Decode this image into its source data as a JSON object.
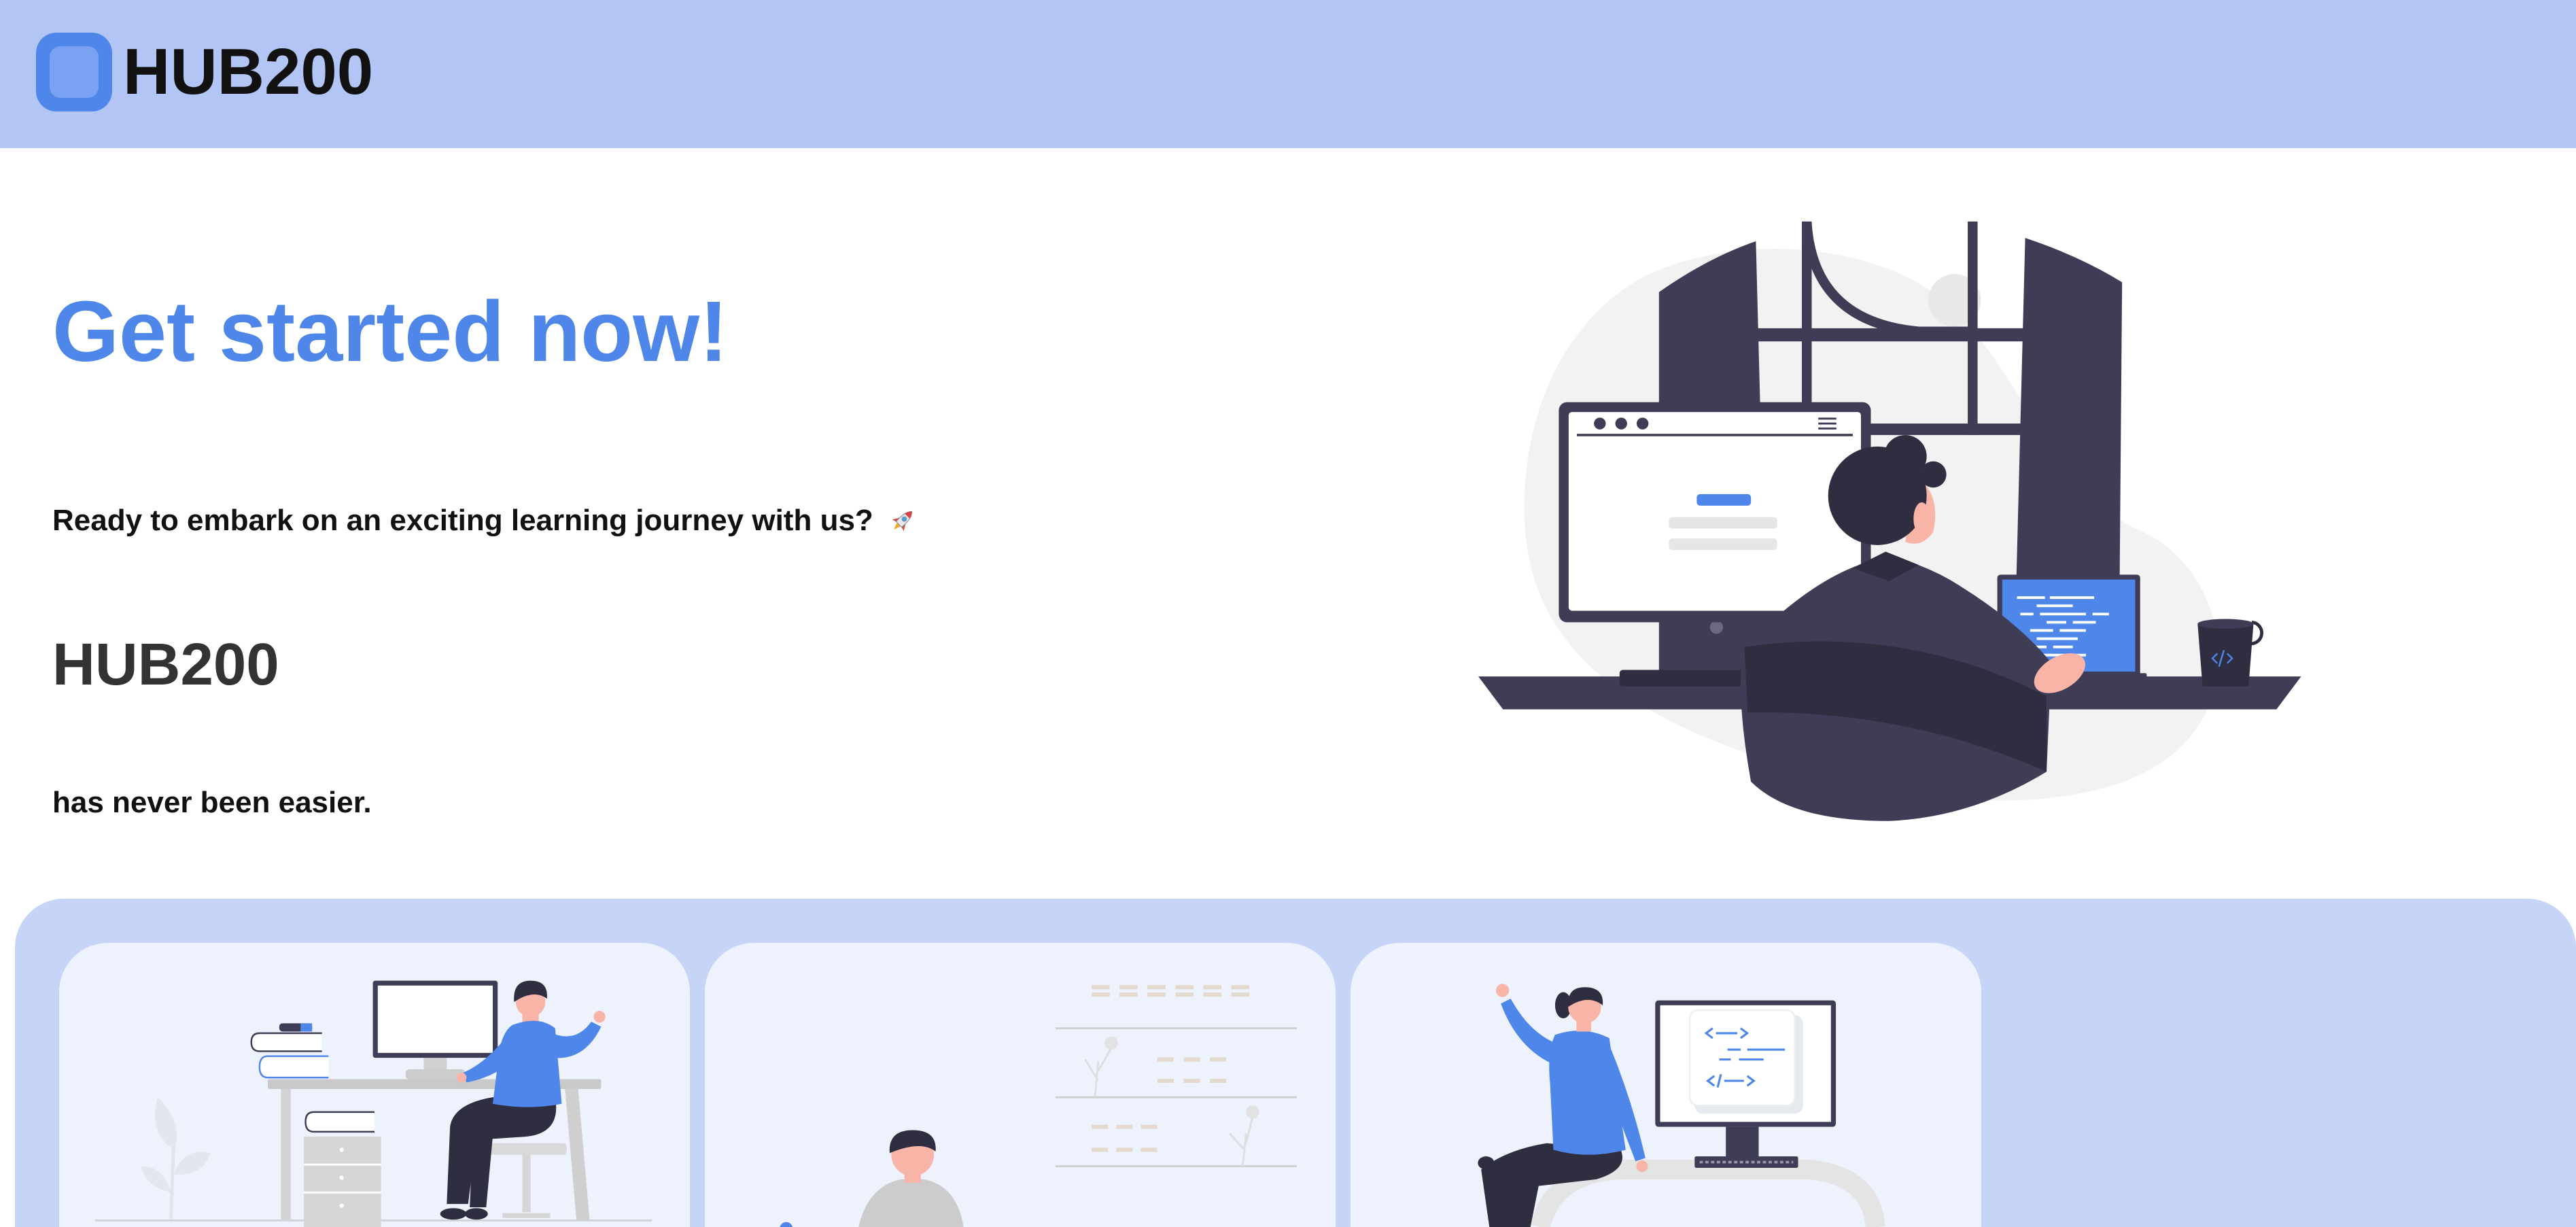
{
  "header": {
    "brand": "HUB200",
    "logo_icon": "logo-square-icon"
  },
  "hero": {
    "title": "Get started now!",
    "subtitle": "Ready to embark on an exciting learning journey with us?",
    "subtitle_icon": "rocket-icon",
    "brand": "HUB200",
    "tagline": "has never been easier.",
    "illustration": "developer-at-desk-illustration"
  },
  "features": {
    "cards": [
      {
        "illustration": "working-at-desk-illustration"
      },
      {
        "illustration": "bookshelf-reader-illustration"
      },
      {
        "illustration": "coding-celebration-illustration"
      }
    ]
  },
  "colors": {
    "header_bg": "#b3c5f4",
    "section_bg": "#c6d4f7",
    "card_bg": "#eef2fd",
    "accent": "#4f86ea",
    "text_dark": "#333333",
    "text_black": "#111111"
  }
}
